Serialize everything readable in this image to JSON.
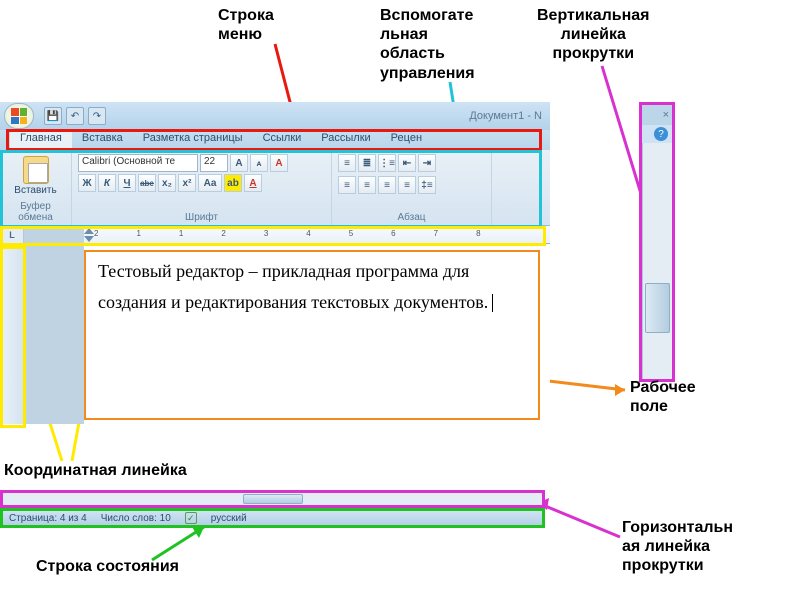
{
  "labels": {
    "menu_row": "Строка\nменю",
    "control_area": "Вспомогате\nльная\nобласть\nуправления",
    "vscroll": "Вертикальная\nлинейка\nпрокрутки",
    "work_field": "Рабочее\nполе",
    "coord_ruler": "Координатная линейка",
    "hscroll": "Горизонтальн\nая линейка\nпрокрутки",
    "status_row": "Строка состояния"
  },
  "titlebar": {
    "document": "Документ1 - N"
  },
  "tabs": [
    "Главная",
    "Вставка",
    "Разметка страницы",
    "Ссылки",
    "Рассылки",
    "Рецен"
  ],
  "ribbon": {
    "paste": "Вставить",
    "clipboard_group": "Буфер обмена",
    "font_name": "Calibri (Основной те",
    "font_size": "22",
    "font_group": "Шрифт",
    "para_group": "Абзац"
  },
  "font_btns": {
    "bold": "Ж",
    "italic": "К",
    "underline": "Ч",
    "strike": "abe",
    "sub": "x₂",
    "sup": "x²",
    "case": "Aa",
    "grow": "A",
    "shrink": "ᴀ",
    "clear": "A"
  },
  "ruler_numbers": [
    "2",
    "1",
    "",
    "1",
    "2",
    "3",
    "4",
    "5",
    "6",
    "7",
    "8"
  ],
  "document_text": "Тестовый редактор – прикладная программа для создания и редактирования текстовых документов.",
  "status": {
    "page": "Страница: 4 из 4",
    "words": "Число слов: 10",
    "lang": "русский"
  },
  "vscroll_buttons": {
    "close": "×",
    "help": "?"
  }
}
